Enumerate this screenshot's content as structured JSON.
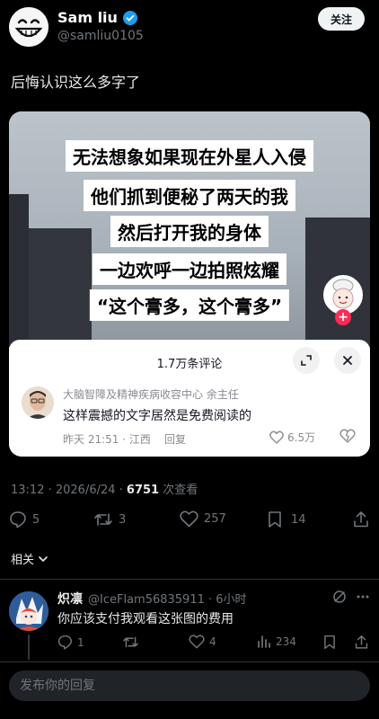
{
  "author": {
    "name": "Sam liu",
    "handle": "@samliu0105",
    "follow_label": "关注"
  },
  "post": {
    "text": "后悔认识这么多字了",
    "timestamp": "13:12 · 2026/6/24 · ",
    "views_count": "6751",
    "views_label": " 次查看"
  },
  "media": {
    "caption_lines": [
      "无法想象如果现在外星人入侵",
      "他们抓到便秘了两天的我",
      "然后打开我的身体",
      "一边欢呼一边拍照炫耀",
      "“这个膏多，这个膏多”"
    ],
    "comment_panel": {
      "title": "1.7万条评论",
      "commenter": "大脑智障及精神疾病收容中心 余主任",
      "comment": "这样震撼的文字居然是免费阅读的",
      "meta": "昨天 21:51 · 江西",
      "reply_label": "回复",
      "likes": "6.5万"
    }
  },
  "actions": {
    "replies": "5",
    "reposts": "3",
    "likes": "257",
    "bookmarks": "14"
  },
  "related_label": "相关",
  "reply": {
    "name": "炽凛",
    "handle": "@IceFlam56835911 · 6小时",
    "text": "你应该支付我观看这张图的费用",
    "replies": "1",
    "likes": "4",
    "views": "234"
  },
  "compose": {
    "placeholder": "发布你的回复"
  },
  "colors": {
    "background": "#000000",
    "verified": "#1d9bf0",
    "tiktok_red": "#fe2c55"
  }
}
